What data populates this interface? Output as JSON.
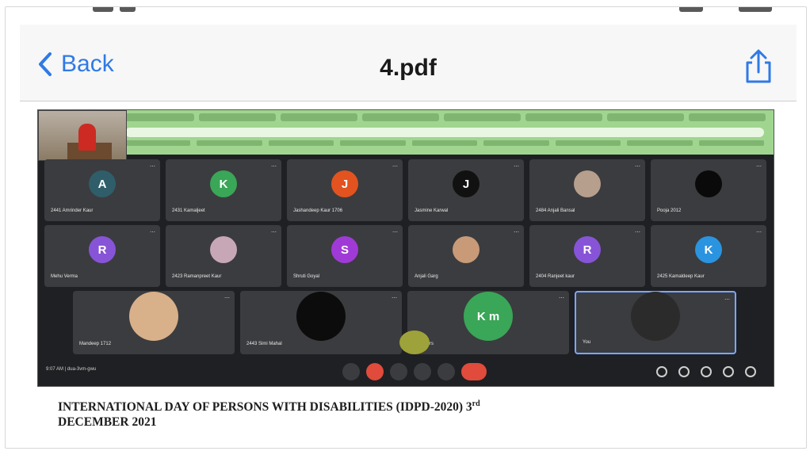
{
  "header": {
    "back_label": "Back",
    "title": "4.pdf"
  },
  "icons": {
    "back": "chevron-left-icon",
    "share": "share-icon"
  },
  "colors": {
    "accent": "#2f7ae6",
    "meet_background": "#1f2023",
    "end_call": "#e04b3c"
  },
  "meeting": {
    "tiles": [
      {
        "initial": "A",
        "name": "2441 Amrinder Kaur",
        "color": "#2f5e6a"
      },
      {
        "initial": "K",
        "name": "2431 Kamaljeet",
        "color": "#3aa657"
      },
      {
        "initial": "J",
        "name": "Jashandeep Kaur 1706",
        "color": "#e2531f"
      },
      {
        "initial": "J",
        "name": "Jasmine Karwal",
        "color": "#111111"
      },
      {
        "initial": "",
        "name": "2484 Anjali Bansal",
        "color": "#b69f8c"
      },
      {
        "initial": "",
        "name": "Pooja 2012",
        "color": "#0a0a0a"
      },
      {
        "initial": "R",
        "name": "Mehu Verma",
        "color": "#8754d8"
      },
      {
        "initial": "",
        "name": "2423 Ramanpreet Kaur",
        "color": "#c7a7b6"
      },
      {
        "initial": "S",
        "name": "Shruti Goyal",
        "color": "#a03ad6"
      },
      {
        "initial": "",
        "name": "Anjali Garg",
        "color": "#c89a78"
      },
      {
        "initial": "R",
        "name": "2404 Ranjeet kaur",
        "color": "#8754d8"
      },
      {
        "initial": "K",
        "name": "2425 Kamaldeep Kaur",
        "color": "#2a94e0"
      },
      {
        "initial": "",
        "name": "Mandeep 1712",
        "color": "#d8b08a"
      },
      {
        "initial": "",
        "name": "2443 Simi Mahal",
        "color": "#0c0c0c"
      },
      {
        "initial": "K m",
        "name": "14 others",
        "color": "#3aa657"
      },
      {
        "initial": "",
        "name": "You",
        "color": "#2b2b2b"
      }
    ],
    "time": "9:07 AM | dua-3vm-gwu"
  },
  "caption": {
    "line1": "INTERNATIONAL DAY OF PERSONS WITH DISABILITIES (IDPD-2020) 3",
    "sup": "rd",
    "line2": "DECEMBER 2021"
  }
}
